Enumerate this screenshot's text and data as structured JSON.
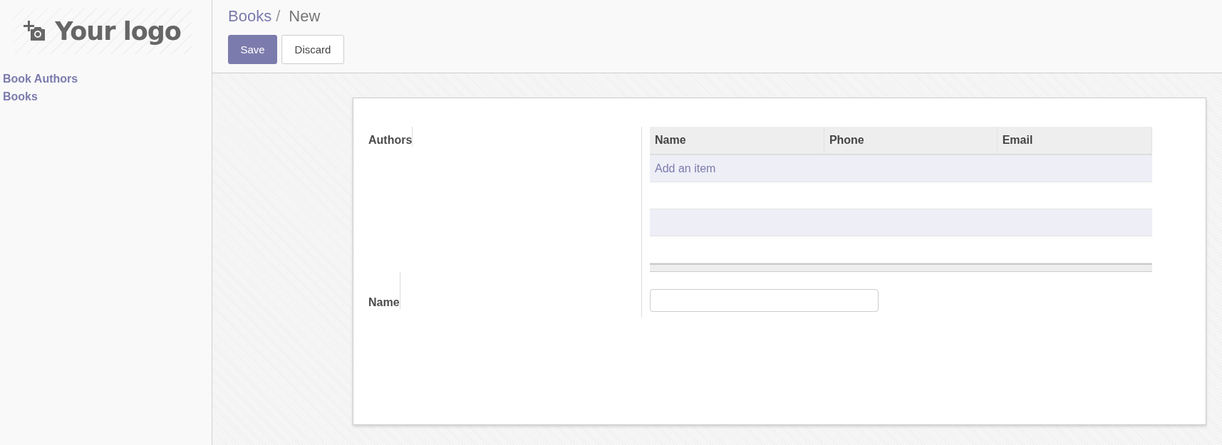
{
  "sidebar": {
    "logo_text": "Your logo",
    "items": [
      {
        "label": "Book Authors"
      },
      {
        "label": "Books"
      }
    ]
  },
  "breadcrumb": {
    "separator": "/",
    "items": [
      {
        "label": "Books",
        "kind": "link"
      },
      {
        "label": "New",
        "kind": "current"
      }
    ]
  },
  "buttons": [
    {
      "label": "Save",
      "kind": "primary"
    },
    {
      "label": "Discard",
      "kind": "secondary"
    }
  ],
  "form": {
    "fields": [
      {
        "label": "Authors",
        "kind": "table",
        "columns": [
          "Name",
          "Phone",
          "Email"
        ],
        "add_item": "Add an item"
      },
      {
        "label": "Name",
        "kind": "text"
      }
    ]
  }
}
